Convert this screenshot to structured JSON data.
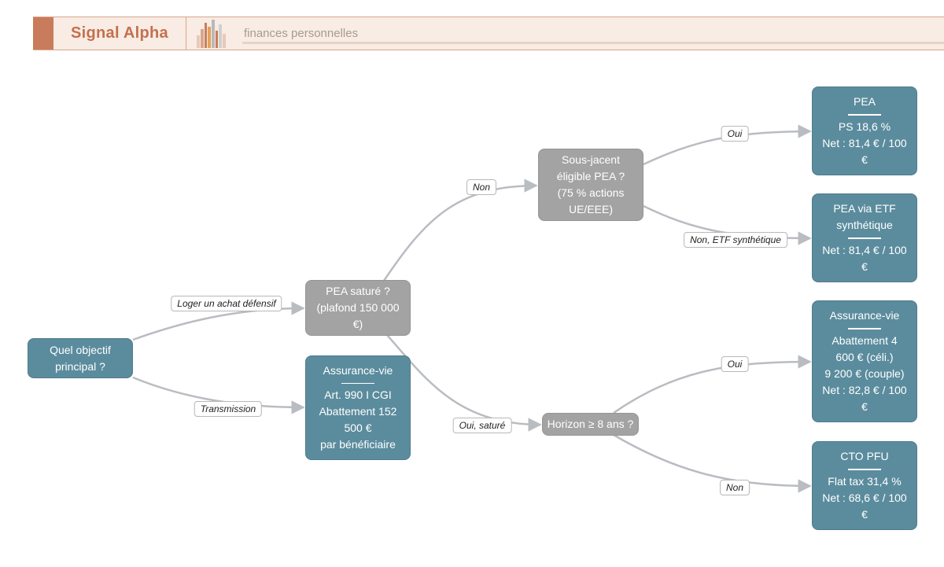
{
  "header": {
    "brand": "Signal Alpha",
    "tagline": "finances personnelles",
    "accent_color": "#c97c5c",
    "logo_icon": "bar-chart-icon"
  },
  "colors": {
    "teal": "#5b8c9d",
    "gray": "#a3a3a3",
    "edge": "#b9bcc1"
  },
  "nodes": {
    "q_objectif": {
      "lines": [
        "Quel objectif",
        "principal ?"
      ]
    },
    "q_pea_sature": {
      "lines": [
        "PEA saturé ?",
        "(plafond 150 000",
        "€)"
      ]
    },
    "av_transmission": {
      "title": "Assurance-vie",
      "lines": [
        "Art. 990 I CGI",
        "Abattement 152",
        "500 €",
        "par bénéficiaire"
      ]
    },
    "q_sous_jacent": {
      "lines": [
        "Sous-jacent",
        "éligible PEA ?",
        "(75 % actions",
        "UE/EEE)"
      ]
    },
    "q_horizon": {
      "lines": [
        "Horizon ≥ 8 ans ?"
      ]
    },
    "r_pea": {
      "title": "PEA",
      "lines": [
        "PS 18,6 %",
        "Net : 81,4 € / 100",
        "€"
      ]
    },
    "r_pea_etf": {
      "title_lines": [
        "PEA via ETF",
        "synthétique"
      ],
      "lines": [
        "Net : 81,4 € / 100",
        "€"
      ]
    },
    "r_av": {
      "title": "Assurance-vie",
      "lines": [
        "Abattement 4",
        "600 € (céli.)",
        "9 200 € (couple)",
        "Net : 82,8 € / 100",
        "€"
      ]
    },
    "r_cto": {
      "title": "CTO PFU",
      "lines": [
        "Flat tax 31,4 %",
        "Net : 68,6 € / 100",
        "€"
      ]
    }
  },
  "edges": [
    {
      "from": "q_objectif",
      "to": "q_pea_sature",
      "label": "Loger un achat défensif"
    },
    {
      "from": "q_objectif",
      "to": "av_transmission",
      "label": "Transmission"
    },
    {
      "from": "q_pea_sature",
      "to": "q_sous_jacent",
      "label": "Non"
    },
    {
      "from": "q_pea_sature",
      "to": "q_horizon",
      "label": "Oui, saturé"
    },
    {
      "from": "q_sous_jacent",
      "to": "r_pea",
      "label": "Oui"
    },
    {
      "from": "q_sous_jacent",
      "to": "r_pea_etf",
      "label": "Non, ETF synthétique"
    },
    {
      "from": "q_horizon",
      "to": "r_av",
      "label": "Oui"
    },
    {
      "from": "q_horizon",
      "to": "r_cto",
      "label": "Non"
    }
  ]
}
